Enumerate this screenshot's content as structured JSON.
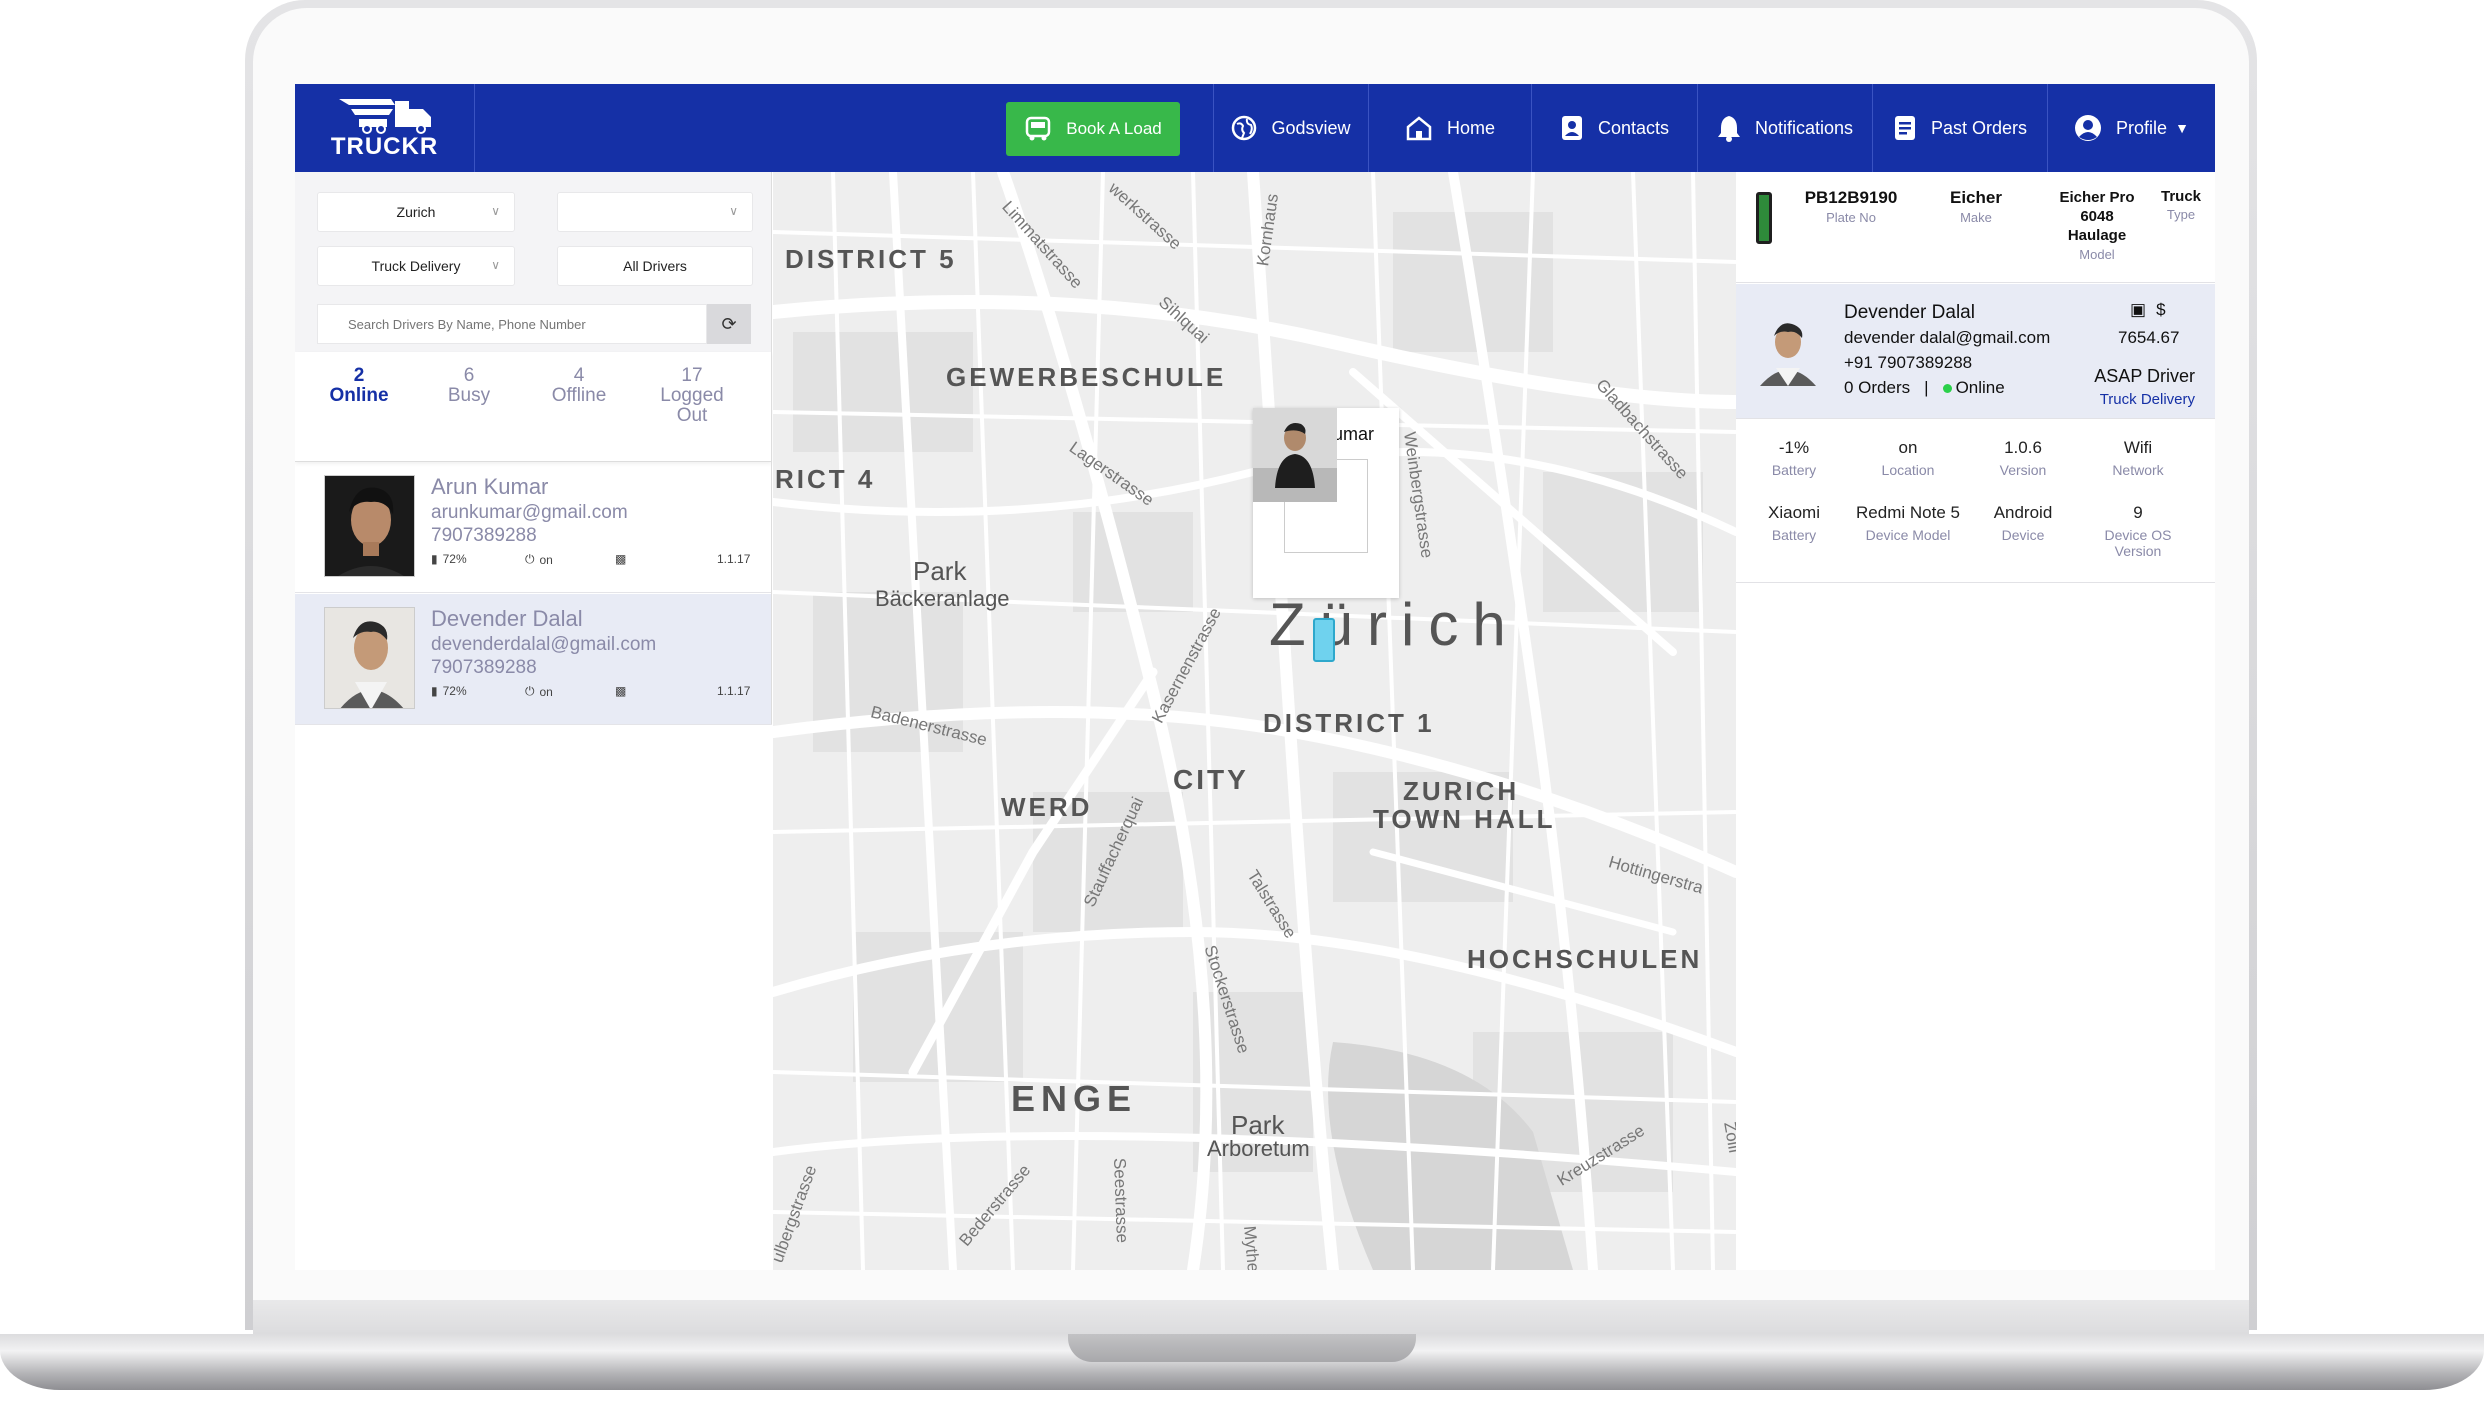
{
  "colors": {
    "nav": "#1530a6",
    "book": "#38b84a",
    "online": "#2bd04a",
    "muted": "#8a8aa8"
  },
  "brand": {
    "logo_text": "TRUCKR"
  },
  "nav": {
    "book_label": "Book A Load",
    "godsview": "Godsview",
    "home": "Home",
    "contacts": "Contacts",
    "notifications": "Notifications",
    "past_orders": "Past Orders",
    "profile": "Profile"
  },
  "filters": {
    "city": "Zurich",
    "second": "",
    "delivery_type": "Truck Delivery",
    "drivers": "All Drivers",
    "search_placeholder": "Search Drivers By Name, Phone Number"
  },
  "stats": [
    {
      "count": "2",
      "label": "Online"
    },
    {
      "count": "6",
      "label": "Busy"
    },
    {
      "count": "4",
      "label": "Offline"
    },
    {
      "count": "17",
      "label": "Logged Out"
    }
  ],
  "drivers": [
    {
      "name": "Arun Kumar",
      "email": "arunkumar@gmail.com",
      "phone": "7907389288",
      "battery": "72%",
      "power": "on",
      "version": "1.1.17"
    },
    {
      "name": "Devender Dalal",
      "email": "devenderdalal@gmail.com",
      "phone": "7907389288",
      "battery": "72%",
      "power": "on",
      "version": "1.1.17"
    }
  ],
  "map": {
    "labels": {
      "district5": "DISTRICT 5",
      "gewerbeschule": "GEWERBESCHULE",
      "district4": "RICT 4",
      "park1a": "Park",
      "park1b": "Bäckeranlage",
      "zurich": "Zürich",
      "district1": "DISTRICT 1",
      "city": "CITY",
      "werd": "WERD",
      "townhall1": "ZURICH",
      "townhall2": "TOWN HALL",
      "hochschulen": "HOCHSCHULEN",
      "enge": "ENGE",
      "park2a": "Park",
      "park2b": "Arboretum"
    },
    "streets": {
      "limmat": "Limmatstrasse",
      "werk": "werkstrasse",
      "kornhaus": "Kornhaus",
      "sihlquai": "Sihlquai",
      "gladbach": "Gladbachstrasse",
      "weinberg": "Weinbergstrasse",
      "lager": "Lagerstrasse",
      "kasernen": "Kasernenstrasse",
      "baden": "Badenerstrasse",
      "stauff": "Stauffacherquai",
      "tal": "Talstrasse",
      "hotting": "Hottingerstra",
      "stocker": "Stockerstrasse",
      "bederl": "Bederstrasse",
      "see": "Seestrasse",
      "kreuz": "Kreuzstrasse",
      "myth": "Mythe",
      "waffel": "ulbergstrasse",
      "zolli": "Zolli"
    },
    "popup_name": "Arun Kumar"
  },
  "vehicle": {
    "plate": "PB12B9190",
    "plate_label": "Plate No",
    "make": "Eicher",
    "make_label": "Make",
    "model_l1": "Eicher Pro",
    "model_l2": "6048",
    "model_l3": "Haulage",
    "model_label": "Model",
    "type": "Truck",
    "type_label": "Type"
  },
  "selected_driver": {
    "name": "Devender Dalal",
    "email": "devender dalal@gmail.com",
    "phone": "+91 7907389288",
    "orders": "0 Orders",
    "separator": "|",
    "status": "Online",
    "currency": "$",
    "amount": "7654.67",
    "mode": "ASAP Driver",
    "delivery": "Truck Delivery"
  },
  "device": [
    {
      "value": "-1%",
      "label": "Battery"
    },
    {
      "value": "on",
      "label": "Location"
    },
    {
      "value": "1.0.6",
      "label": "Version"
    },
    {
      "value": "Wifi",
      "label": "Network"
    },
    {
      "value": "Xiaomi",
      "label": "Battery"
    },
    {
      "value": "Redmi Note 5",
      "label": "Device Model"
    },
    {
      "value": "Android",
      "label": "Device"
    },
    {
      "value": "9",
      "label": "Device OS Version"
    }
  ]
}
